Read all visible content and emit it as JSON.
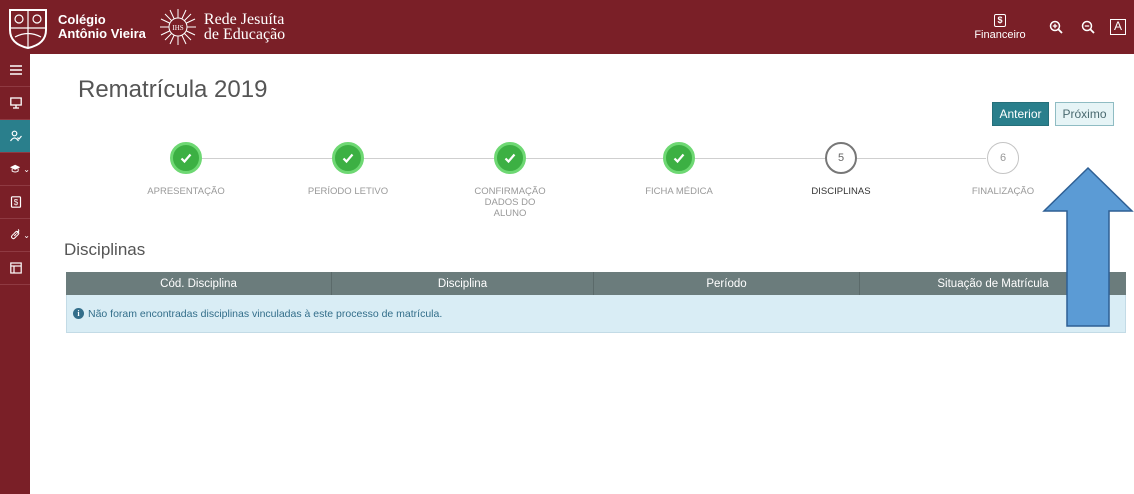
{
  "header": {
    "school_line1": "Colégio",
    "school_line2": "Antônio Vieira",
    "network_line1": "Rede Jesuíta",
    "network_line2": "de Educação",
    "logo_text": "IHS",
    "financeiro_label": "Financeiro",
    "font_button_label": "A"
  },
  "sidebar": {
    "items": [
      {
        "icon": "menu-icon"
      },
      {
        "icon": "monitor-icon"
      },
      {
        "icon": "user-check-icon"
      },
      {
        "icon": "graduation-cap-icon"
      },
      {
        "icon": "dollar-doc-icon"
      },
      {
        "icon": "link-icon"
      },
      {
        "icon": "table-icon"
      }
    ]
  },
  "page": {
    "title": "Rematrícula 2019",
    "prev_button": "Anterior",
    "next_button": "Próximo",
    "section_title": "Disciplinas"
  },
  "steps": [
    {
      "label": "APRESENTAÇÃO",
      "state": "done"
    },
    {
      "label": "PERÍODO LETIVO",
      "state": "done"
    },
    {
      "label": "CONFIRMAÇÃO\nDADOS DO\nALUNO",
      "state": "done"
    },
    {
      "label": "FICHA MÉDICA",
      "state": "done"
    },
    {
      "label": "DISCIPLINAS",
      "number": "5",
      "state": "current"
    },
    {
      "label": "FINALIZAÇÃO",
      "number": "6",
      "state": "todo"
    }
  ],
  "table": {
    "columns": [
      "Cód. Disciplina",
      "Disciplina",
      "Período",
      "Situação de Matrícula"
    ],
    "empty_message": "Não foram encontradas disciplinas vinculadas à este processo de matrícula."
  },
  "colors": {
    "brand": "#7a1f27",
    "accent": "#2a7f8c",
    "success": "#3cb043",
    "arrow_fill": "#5b9bd5"
  }
}
